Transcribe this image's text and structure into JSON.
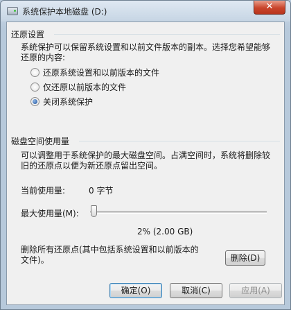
{
  "window": {
    "title": "系统保护本地磁盘 (D:)",
    "close_label": "✕"
  },
  "restore": {
    "heading": "还原设置",
    "description_line1": "系统保护可以保留系统设置和以前文件版本的副本。选择您希望能够",
    "description_line2": "还原的内容:",
    "options": [
      {
        "label": "还原系统设置和以前版本的文件",
        "checked": false
      },
      {
        "label": "仅还原以前版本的文件",
        "checked": false
      },
      {
        "label": "关闭系统保护",
        "checked": true
      }
    ]
  },
  "disk": {
    "heading": "磁盘空间使用量",
    "description_line1": "可以调整用于系统保护的最大磁盘空间。占满空间时，系统将删除较",
    "description_line2": "旧的还原点以便为新还原点留出空间。",
    "current_label": "当前使用量:",
    "current_value": "0 字节",
    "max_label": "最大使用量(M):",
    "slider_fraction": 0.02,
    "max_value": "2% (2.00 GB)"
  },
  "delete": {
    "text_line1": "删除所有还原点(其中包括系统设置和以前版本的",
    "text_line2": "文件)。",
    "button_label": "删除(D)"
  },
  "footer": {
    "ok_label": "确定(O)",
    "cancel_label": "取消(C)",
    "apply_label": "应用(A)"
  }
}
